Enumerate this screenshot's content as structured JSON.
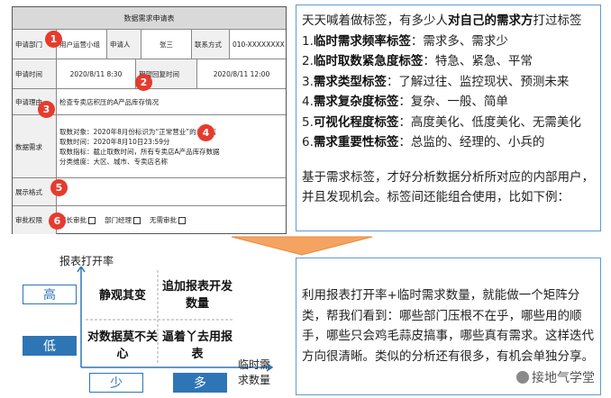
{
  "form": {
    "title": "数据需求申请表",
    "rows": {
      "r1": {
        "dept_label": "申请部门",
        "dept_value": "用户运营小组",
        "person_label": "申请人",
        "person_value": "张三",
        "contact_label": "联系方式",
        "contact_value": "010-XXXXXXXX"
      },
      "r2": {
        "time_label": "申请时间",
        "time_value": "2020/8/11 8:30",
        "reply_label": "期望回复时间",
        "reply_value": "2020/8/11 12:00"
      },
      "r3": {
        "reason_label": "申请理由",
        "reason_value": "检查专卖店积压的A产品库存情况"
      },
      "r4": {
        "need_label": "数据需求",
        "lines": [
          "取数对象：2020年8月份标识为“正常营业”的专卖店",
          "取数时间：2020年8月10日23:59分",
          "取数指标：截止取数时间，所有专卖店A产品库存数据",
          "分类维度：大区、城市、专卖店名称"
        ]
      },
      "r5": {
        "format_label": "展示格式"
      },
      "r6": {
        "approve_label": "审批权限",
        "options": [
          "组长审批",
          "部门经理",
          "无需审批"
        ]
      }
    },
    "badges": [
      "1",
      "2",
      "3",
      "4",
      "5",
      "6"
    ]
  },
  "tag_panel": {
    "intro": {
      "pre": "天天喊着做标签，有多少人",
      "bold": "对自己的需求方",
      "post": "打过标签"
    },
    "items": [
      {
        "num": "1.",
        "bold": "临时需求频率标签",
        "text": "：需求多、需求少"
      },
      {
        "num": "2.",
        "bold": "临时取数紧急度标签",
        "text": "：特急、紧急、平常"
      },
      {
        "num": "3.",
        "bold": "需求类型标签",
        "text": "：了解过往、监控现状、预测未来"
      },
      {
        "num": "4.",
        "bold": "需求复杂度标签",
        "text": "：复杂、一般、简单"
      },
      {
        "num": "5.",
        "bold": "可视化程度标签",
        "text": "：高度美化、低度美化、无需美化"
      },
      {
        "num": "6.",
        "bold": "需求重要性标签",
        "text": "：总监的、经理的、小兵的"
      }
    ],
    "summary": "基于需求标签，才好分析数据分析所对应的内部用户，并且发现机会。标签间还能组合使用，比如下例："
  },
  "matrix": {
    "y_axis_label": "报表打开率",
    "x_axis_label_line1": "临时需",
    "x_axis_label_line2": "求数量",
    "y_high": "高",
    "y_low": "低",
    "x_low": "少",
    "x_high": "多",
    "q_top_left": "静观其变",
    "q_top_right": "追加报表开发数量",
    "q_bottom_left": "对数据莫不关心",
    "q_bottom_right": "逼着丫去用报表",
    "colors": {
      "axis_box": "#2e75b6",
      "arrow": "#f4a460"
    }
  },
  "analysis": {
    "text": "利用报表打开率+临时需求数量，就能做一个矩阵分类，帮我们看到：哪些部门压根不在乎，哪些用的顺手，哪些只会鸡毛蒜皮搞事，哪些真有需求。这样迭代方向很清晰。类似的分析还有很多，有机会单独分享。",
    "watermark": "接地气学堂"
  }
}
